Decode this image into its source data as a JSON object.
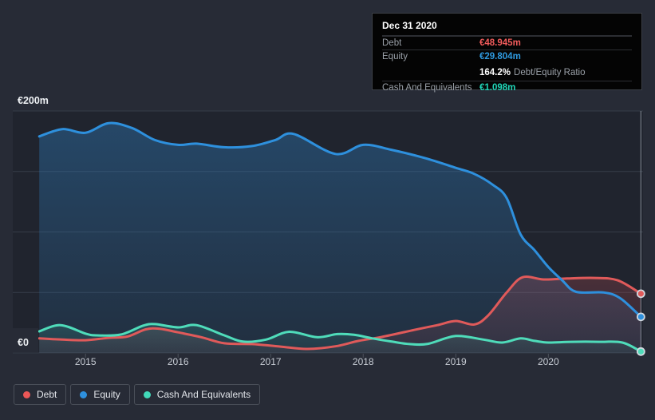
{
  "tooltip": {
    "date": "Dec 31 2020",
    "rows": [
      {
        "label": "Debt",
        "value": "€48.945m"
      },
      {
        "label": "Equity",
        "value": "€29.804m"
      },
      {
        "label": "Cash And Equivalents",
        "value": "€1.098m"
      }
    ],
    "ratio": {
      "value": "164.2%",
      "suffix": "Debt/Equity Ratio"
    }
  },
  "legend": {
    "items": [
      {
        "label": "Debt",
        "color": "#eb5757"
      },
      {
        "label": "Equity",
        "color": "#2e90dd"
      },
      {
        "label": "Cash And Equivalents",
        "color": "#41d9b9"
      }
    ]
  },
  "chart_data": {
    "type": "area",
    "title": "",
    "x_range": [
      2014.49,
      2021.01
    ],
    "y_range": [
      0,
      200
    ],
    "y_gridlines": [
      0,
      50,
      100,
      150,
      200
    ],
    "y_labels": [
      {
        "value": 200,
        "label": "€200m"
      },
      {
        "value": 0,
        "label": "€0"
      }
    ],
    "x_ticks": [
      {
        "value": 2015,
        "label": "2015"
      },
      {
        "value": 2016,
        "label": "2016"
      },
      {
        "value": 2017,
        "label": "2017"
      },
      {
        "value": 2018,
        "label": "2018"
      },
      {
        "value": 2019,
        "label": "2019"
      },
      {
        "value": 2020,
        "label": "2020"
      }
    ],
    "hover_x": 2021.0,
    "legend_position": "bottom-left",
    "grid": true,
    "series": [
      {
        "name": "Debt",
        "color": "#e05a5a",
        "fill_top": "rgba(222,88,95,0.22)",
        "fill_bottom": "rgba(222,88,95,0.08)",
        "values": [
          [
            2014.5,
            12
          ],
          [
            2014.75,
            11
          ],
          [
            2015.0,
            10.5
          ],
          [
            2015.25,
            12.5
          ],
          [
            2015.45,
            13.5
          ],
          [
            2015.65,
            19.5
          ],
          [
            2015.8,
            20
          ],
          [
            2016.0,
            17
          ],
          [
            2016.25,
            13
          ],
          [
            2016.5,
            8
          ],
          [
            2016.8,
            7.3
          ],
          [
            2017.1,
            5.3
          ],
          [
            2017.4,
            3.3
          ],
          [
            2017.7,
            5.5
          ],
          [
            2017.95,
            10
          ],
          [
            2018.2,
            13.2
          ],
          [
            2018.55,
            19
          ],
          [
            2018.8,
            23
          ],
          [
            2019.0,
            26.4
          ],
          [
            2019.2,
            23.5
          ],
          [
            2019.35,
            31
          ],
          [
            2019.55,
            50
          ],
          [
            2019.72,
            62.5
          ],
          [
            2019.95,
            60.7
          ],
          [
            2020.2,
            61.5
          ],
          [
            2020.5,
            62
          ],
          [
            2020.75,
            60
          ],
          [
            2021.0,
            48.945
          ]
        ]
      },
      {
        "name": "Equity",
        "color": "#2e90dd",
        "fill_top": "rgba(46,125,190,0.40)",
        "fill_bottom": "rgba(46,125,190,0.12)",
        "values": [
          [
            2014.5,
            179
          ],
          [
            2014.75,
            185
          ],
          [
            2015.0,
            182
          ],
          [
            2015.25,
            190
          ],
          [
            2015.5,
            186
          ],
          [
            2015.75,
            176
          ],
          [
            2016.0,
            172
          ],
          [
            2016.2,
            173
          ],
          [
            2016.5,
            170
          ],
          [
            2016.8,
            171
          ],
          [
            2017.05,
            176
          ],
          [
            2017.25,
            181
          ],
          [
            2017.7,
            164.5
          ],
          [
            2018.0,
            172
          ],
          [
            2018.3,
            168
          ],
          [
            2018.67,
            161
          ],
          [
            2019.0,
            153
          ],
          [
            2019.2,
            148
          ],
          [
            2019.4,
            139
          ],
          [
            2019.55,
            128
          ],
          [
            2019.7,
            98
          ],
          [
            2019.85,
            85
          ],
          [
            2020.0,
            71
          ],
          [
            2020.15,
            60
          ],
          [
            2020.3,
            50.5
          ],
          [
            2020.6,
            50
          ],
          [
            2020.78,
            45
          ],
          [
            2021.0,
            29.804
          ]
        ]
      },
      {
        "name": "Cash And Equivalents",
        "color": "#4fdcba",
        "fill_top": "rgba(70,215,185,0.16)",
        "fill_bottom": "rgba(70,215,185,0.05)",
        "values": [
          [
            2014.5,
            17.8
          ],
          [
            2014.73,
            23
          ],
          [
            2015.0,
            16
          ],
          [
            2015.12,
            14.5
          ],
          [
            2015.38,
            15.2
          ],
          [
            2015.62,
            22.5
          ],
          [
            2015.75,
            23.8
          ],
          [
            2016.0,
            21.1
          ],
          [
            2016.2,
            23
          ],
          [
            2016.5,
            14.5
          ],
          [
            2016.7,
            9.4
          ],
          [
            2016.95,
            11
          ],
          [
            2017.2,
            17.5
          ],
          [
            2017.5,
            13
          ],
          [
            2017.72,
            15.6
          ],
          [
            2017.9,
            15
          ],
          [
            2018.1,
            12
          ],
          [
            2018.3,
            9.5
          ],
          [
            2018.5,
            7.3
          ],
          [
            2018.7,
            7.5
          ],
          [
            2019.0,
            14
          ],
          [
            2019.3,
            11
          ],
          [
            2019.5,
            8.6
          ],
          [
            2019.7,
            12
          ],
          [
            2019.85,
            10
          ],
          [
            2020.0,
            8.6
          ],
          [
            2020.25,
            9.2
          ],
          [
            2020.55,
            9.2
          ],
          [
            2020.8,
            8.6
          ],
          [
            2021.0,
            1.098
          ]
        ]
      }
    ]
  },
  "colors": {
    "page_bg": "#272b36",
    "plot_bg": "#20242e",
    "gridline": "#363c48",
    "tick": "#4d535c",
    "axis_label": "#eef1f4",
    "x_label": "#c6cbd3",
    "crosshair": "#9aa4ae"
  }
}
